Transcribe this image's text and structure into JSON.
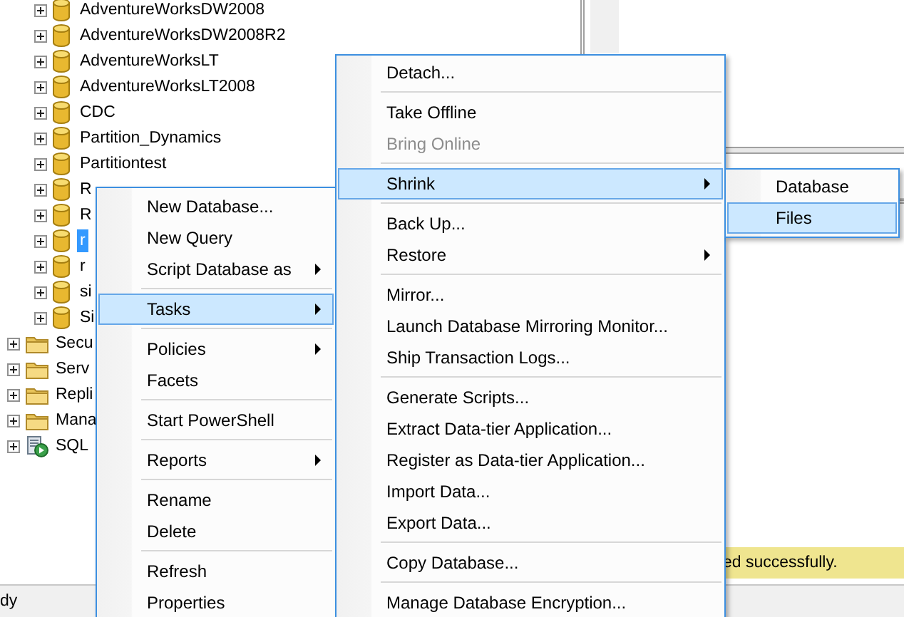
{
  "tree": {
    "items": [
      {
        "label": "AdventureWorksDW2008",
        "kind": "database",
        "selected": false,
        "expanded": false
      },
      {
        "label": "AdventureWorksDW2008R2",
        "kind": "database",
        "selected": false,
        "expanded": false
      },
      {
        "label": "AdventureWorksLT",
        "kind": "database",
        "selected": false,
        "expanded": false
      },
      {
        "label": "AdventureWorksLT2008",
        "kind": "database",
        "selected": false,
        "expanded": false
      },
      {
        "label": "CDC",
        "kind": "database",
        "selected": false,
        "expanded": false
      },
      {
        "label": "Partition_Dynamics",
        "kind": "database",
        "selected": false,
        "expanded": false
      },
      {
        "label": "Partitiontest",
        "kind": "database",
        "selected": false,
        "expanded": false
      },
      {
        "label": "R",
        "kind": "database",
        "selected": false,
        "expanded": false
      },
      {
        "label": "R",
        "kind": "database",
        "selected": false,
        "expanded": false
      },
      {
        "label": "r",
        "kind": "database",
        "selected": true,
        "expanded": false
      },
      {
        "label": "r",
        "kind": "database",
        "selected": false,
        "expanded": false
      },
      {
        "label": "si",
        "kind": "database",
        "selected": false,
        "expanded": false
      },
      {
        "label": "Si",
        "kind": "database",
        "selected": false,
        "expanded": false
      },
      {
        "label": "Secu",
        "kind": "folder",
        "selected": false,
        "expanded": false
      },
      {
        "label": "Serv",
        "kind": "folder",
        "selected": false,
        "expanded": false
      },
      {
        "label": "Repli",
        "kind": "folder",
        "selected": false,
        "expanded": false
      },
      {
        "label": "Mana",
        "kind": "folder",
        "selected": false,
        "expanded": false
      },
      {
        "label": "SQL",
        "kind": "agent",
        "selected": false,
        "expanded": false
      }
    ]
  },
  "message": "ed successfully.",
  "status_bar": "dy",
  "menus": [
    {
      "items": [
        {
          "kind": "item",
          "label": "New Database...",
          "selected": false,
          "disabled": false,
          "submenu": false
        },
        {
          "kind": "item",
          "label": "New Query",
          "selected": false,
          "disabled": false,
          "submenu": false
        },
        {
          "kind": "item",
          "label": "Script Database as",
          "selected": false,
          "disabled": false,
          "submenu": true
        },
        {
          "kind": "separator"
        },
        {
          "kind": "item",
          "label": "Tasks",
          "selected": true,
          "disabled": false,
          "submenu": true
        },
        {
          "kind": "separator"
        },
        {
          "kind": "item",
          "label": "Policies",
          "selected": false,
          "disabled": false,
          "submenu": true
        },
        {
          "kind": "item",
          "label": "Facets",
          "selected": false,
          "disabled": false,
          "submenu": false
        },
        {
          "kind": "separator"
        },
        {
          "kind": "item",
          "label": "Start PowerShell",
          "selected": false,
          "disabled": false,
          "submenu": false
        },
        {
          "kind": "separator"
        },
        {
          "kind": "item",
          "label": "Reports",
          "selected": false,
          "disabled": false,
          "submenu": true
        },
        {
          "kind": "separator"
        },
        {
          "kind": "item",
          "label": "Rename",
          "selected": false,
          "disabled": false,
          "submenu": false
        },
        {
          "kind": "item",
          "label": "Delete",
          "selected": false,
          "disabled": false,
          "submenu": false
        },
        {
          "kind": "separator"
        },
        {
          "kind": "item",
          "label": "Refresh",
          "selected": false,
          "disabled": false,
          "submenu": false
        },
        {
          "kind": "item",
          "label": "Properties",
          "selected": false,
          "disabled": false,
          "submenu": false
        }
      ]
    },
    {
      "items": [
        {
          "kind": "item",
          "label": "Detach...",
          "selected": false,
          "disabled": false,
          "submenu": false
        },
        {
          "kind": "separator"
        },
        {
          "kind": "item",
          "label": "Take Offline",
          "selected": false,
          "disabled": false,
          "submenu": false
        },
        {
          "kind": "item",
          "label": "Bring Online",
          "selected": false,
          "disabled": true,
          "submenu": false
        },
        {
          "kind": "separator"
        },
        {
          "kind": "item",
          "label": "Shrink",
          "selected": true,
          "disabled": false,
          "submenu": true
        },
        {
          "kind": "separator"
        },
        {
          "kind": "item",
          "label": "Back Up...",
          "selected": false,
          "disabled": false,
          "submenu": false
        },
        {
          "kind": "item",
          "label": "Restore",
          "selected": false,
          "disabled": false,
          "submenu": true
        },
        {
          "kind": "separator"
        },
        {
          "kind": "item",
          "label": "Mirror...",
          "selected": false,
          "disabled": false,
          "submenu": false
        },
        {
          "kind": "item",
          "label": "Launch Database Mirroring Monitor...",
          "selected": false,
          "disabled": false,
          "submenu": false
        },
        {
          "kind": "item",
          "label": "Ship Transaction Logs...",
          "selected": false,
          "disabled": false,
          "submenu": false
        },
        {
          "kind": "separator"
        },
        {
          "kind": "item",
          "label": "Generate Scripts...",
          "selected": false,
          "disabled": false,
          "submenu": false
        },
        {
          "kind": "item",
          "label": "Extract Data-tier Application...",
          "selected": false,
          "disabled": false,
          "submenu": false
        },
        {
          "kind": "item",
          "label": "Register as Data-tier Application...",
          "selected": false,
          "disabled": false,
          "submenu": false
        },
        {
          "kind": "item",
          "label": "Import Data...",
          "selected": false,
          "disabled": false,
          "submenu": false
        },
        {
          "kind": "item",
          "label": "Export Data...",
          "selected": false,
          "disabled": false,
          "submenu": false
        },
        {
          "kind": "separator"
        },
        {
          "kind": "item",
          "label": "Copy Database...",
          "selected": false,
          "disabled": false,
          "submenu": false
        },
        {
          "kind": "separator"
        },
        {
          "kind": "item",
          "label": "Manage Database Encryption...",
          "selected": false,
          "disabled": false,
          "submenu": false
        }
      ]
    },
    {
      "items": [
        {
          "kind": "item",
          "label": "Database",
          "selected": false,
          "disabled": false,
          "submenu": false
        },
        {
          "kind": "item",
          "label": "Files",
          "selected": true,
          "disabled": false,
          "submenu": false
        }
      ]
    }
  ]
}
